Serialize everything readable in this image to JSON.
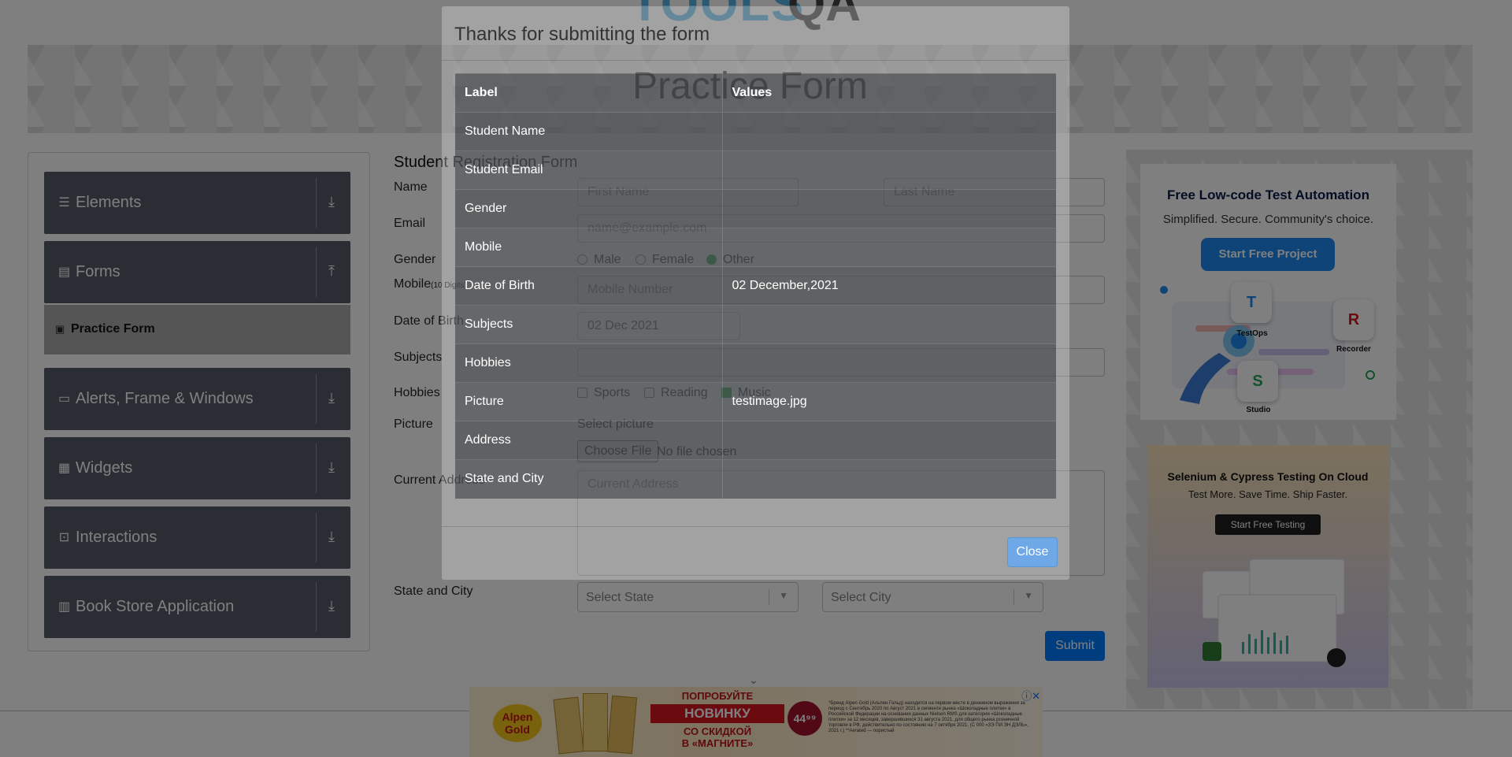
{
  "header": {
    "logo_text": "TOOLS",
    "logo_suffix": "QA",
    "banner_title": "Practice Form"
  },
  "sidebar": {
    "groups": [
      {
        "label": "Elements",
        "icon": "hamburger-icon"
      },
      {
        "label": "Forms",
        "icon": "document-icon"
      },
      {
        "label": "Alerts, Frame & Windows",
        "icon": "window-icon"
      },
      {
        "label": "Widgets",
        "icon": "grid-icon"
      },
      {
        "label": "Interactions",
        "icon": "cursor-icon"
      },
      {
        "label": "Book Store Application",
        "icon": "books-icon"
      }
    ],
    "active_item": "Practice Form"
  },
  "form": {
    "title": "Student Registration Form",
    "labels": {
      "name": "Name",
      "email": "Email",
      "gender": "Gender",
      "mobile": "Mobile",
      "mobile_hint": "(10 Digits)",
      "dob": "Date of Birth",
      "subjects": "Subjects",
      "hobbies": "Hobbies",
      "picture": "Picture",
      "address": "Current Address",
      "state_city": "State and City"
    },
    "first_name_placeholder": "First Name",
    "last_name_placeholder": "Last Name",
    "email_placeholder": "name@example.com",
    "gender_options": [
      "Male",
      "Female",
      "Other"
    ],
    "gender_selected": "Other",
    "mobile_placeholder": "Mobile Number",
    "dob_value": "02 Dec 2021",
    "hobby_options": [
      "Sports",
      "Reading",
      "Music"
    ],
    "hobby_checked": "Music",
    "select_picture": "Select picture",
    "file_button": "Choose File",
    "file_status": "No file chosen",
    "address_placeholder": "Current Address",
    "state_placeholder": "Select State",
    "city_placeholder": "Select City",
    "submit_label": "Submit"
  },
  "ads": {
    "right1": {
      "headline": "Free Low-code Test Automation",
      "sub": "Simplified. Secure. Community's choice.",
      "button": "Start Free Project",
      "tiles": [
        "TestOps",
        "Recorder",
        "Studio"
      ]
    },
    "right2": {
      "headline": "Selenium & Cypress Testing On Cloud",
      "sub": "Test More. Save Time. Ship Faster.",
      "button": "Start Free Testing"
    },
    "bottom": {
      "brand": "Alpen Gold",
      "line1": "ПОПРОБУЙТЕ",
      "line2": "НОВИНКУ",
      "line3": "СО СКИДКОЙ",
      "line4": "В «МАГНИТЕ»",
      "price": "44⁹⁹",
      "fine_print": "*Бренд Alpen Gold (Альпен Гольд) находится на первом месте в денежном выражении за период с Сентябрь 2020 по Август 2021 в сегменте рынка «Шоколадные плитки» в Российской Федерации на основании данных Nielsen RMS для категории «Шоколадные плитки» за 12 месяцев, завершившихся 31 августа 2021, для общего рынка розничной торговли в РФ, действительно по состоянию на 7 октября 2021. (С 000 «ЗЭ ПИ ЭН ДЭЛЬ», 2021 г.) **Aerated — пористый"
    }
  },
  "modal": {
    "title": "Thanks for submitting the form",
    "header": [
      "Label",
      "Values"
    ],
    "rows": [
      [
        "Student Name",
        ""
      ],
      [
        "Student Email",
        ""
      ],
      [
        "Gender",
        ""
      ],
      [
        "Mobile",
        ""
      ],
      [
        "Date of Birth",
        "02 December,2021"
      ],
      [
        "Subjects",
        ""
      ],
      [
        "Hobbies",
        ""
      ],
      [
        "Picture",
        "testimage.jpg"
      ],
      [
        "Address",
        ""
      ],
      [
        "State and City",
        ""
      ]
    ],
    "close_label": "Close"
  }
}
